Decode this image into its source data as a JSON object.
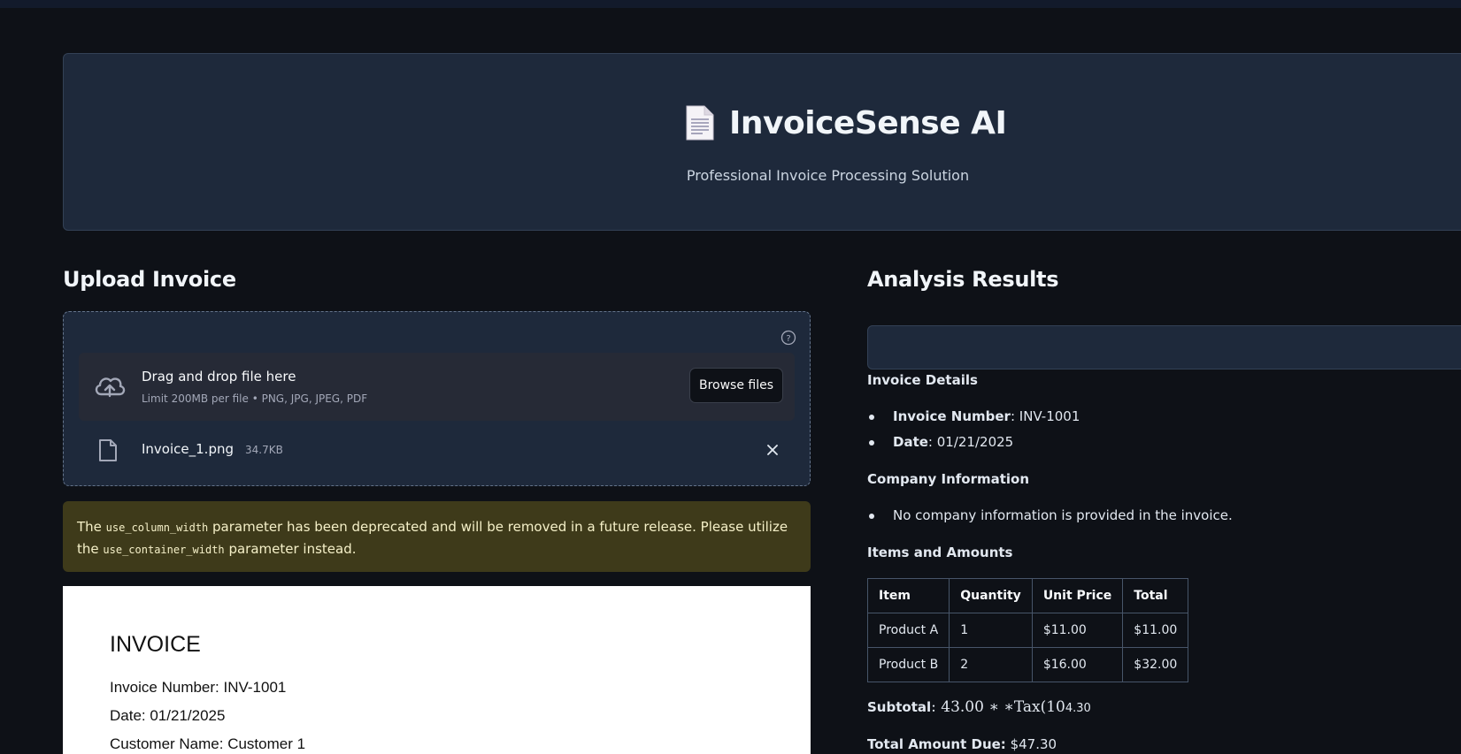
{
  "header": {
    "title": "InvoiceSense AI",
    "subtitle": "Professional Invoice Processing Solution",
    "icon": "document-icon"
  },
  "upload": {
    "heading": "Upload Invoice",
    "drop_title": "Drag and drop file here",
    "drop_hint": "Limit 200MB per file • PNG, JPG, JPEG, PDF",
    "browse_label": "Browse files",
    "file": {
      "name": "Invoice_1.png",
      "size": "34.7KB"
    }
  },
  "warning": {
    "text_before": "The ",
    "code1": "use_column_width",
    "text_middle": " parameter has been deprecated and will be removed in a future release. Please utilize the ",
    "code2": "use_container_width",
    "text_after": " parameter instead."
  },
  "invoice_preview": {
    "title": "INVOICE",
    "lines": [
      "Invoice Number: INV-1001",
      "Date: 01/21/2025",
      "Customer Name: Customer 1"
    ]
  },
  "results": {
    "heading": "Analysis Results",
    "invoice_details_label": "Invoice Details",
    "invoice_number_key": "Invoice Number",
    "invoice_number_value": ": INV-1001",
    "date_key": "Date",
    "date_value": ": 01/21/2025",
    "company_label": "Company Information",
    "company_text": "No company information is provided in the invoice.",
    "items_label": "Items and Amounts",
    "table": {
      "headers": [
        "Item",
        "Quantity",
        "Unit Price",
        "Total"
      ],
      "rows": [
        [
          "Product A",
          "1",
          "$11.00",
          "$11.00"
        ],
        [
          "Product B",
          "2",
          "$16.00",
          "$32.00"
        ]
      ]
    },
    "subtotal_key": "Subtotal",
    "subtotal_math": ": 43.00 ∗ ∗Tax(10",
    "subtotal_tail": "4.30",
    "total_key": "Total Amount Due:",
    "total_value": " $47.30"
  }
}
